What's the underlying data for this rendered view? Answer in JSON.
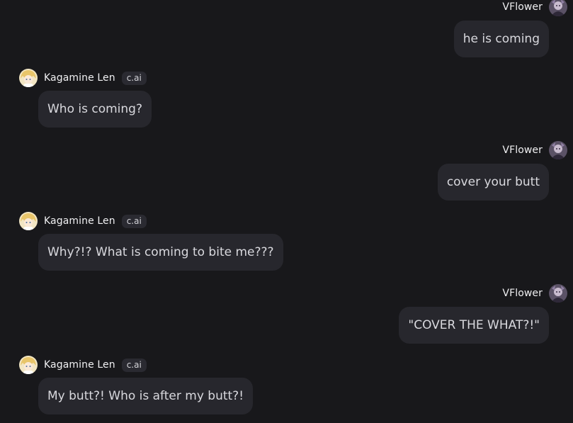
{
  "user": {
    "name": "VFlower"
  },
  "bot": {
    "name": "Kagamine Len",
    "badge": "c.ai"
  },
  "messages": [
    {
      "sender": "user",
      "text": "he is coming"
    },
    {
      "sender": "bot",
      "text": "Who is coming?"
    },
    {
      "sender": "user",
      "text": "cover your butt"
    },
    {
      "sender": "bot",
      "text": "Why?!? What is coming to bite me???"
    },
    {
      "sender": "user",
      "text": "\"COVER THE WHAT?!\""
    },
    {
      "sender": "bot",
      "text": "My butt?! Who is after my butt?!"
    }
  ],
  "icons": {
    "user_avatar": "user-avatar-icon",
    "bot_avatar": "bot-avatar-icon"
  }
}
